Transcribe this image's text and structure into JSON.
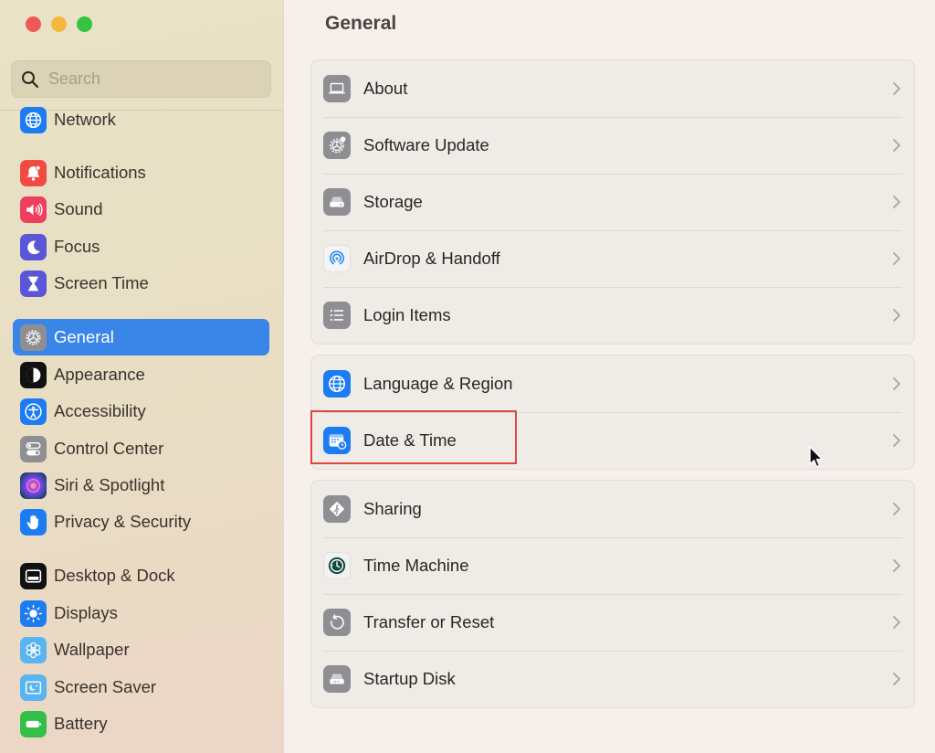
{
  "window": {
    "controls": [
      {
        "name": "close-button",
        "color": "#ed5a55"
      },
      {
        "name": "minimize-button",
        "color": "#f5b83a"
      },
      {
        "name": "maximize-button",
        "color": "#36c342"
      }
    ]
  },
  "search": {
    "placeholder": "Search",
    "value": "",
    "icon": "search-icon"
  },
  "sidebar": {
    "selected": "General",
    "accent_color": "#3a86e8",
    "items": [
      {
        "label": "Network",
        "icon": "globe-icon",
        "color": "#1d7cf2"
      },
      {
        "label": "Notifications",
        "icon": "bell-icon",
        "color": "#f04a42"
      },
      {
        "label": "Sound",
        "icon": "speaker-icon",
        "color": "#ee3f5d"
      },
      {
        "label": "Focus",
        "icon": "moon-icon",
        "color": "#5b56d8"
      },
      {
        "label": "Screen Time",
        "icon": "hourglass-icon",
        "color": "#5b56d8"
      },
      {
        "label": "General",
        "icon": "gear-icon",
        "color": "#8e8e93"
      },
      {
        "label": "Appearance",
        "icon": "appearance-icon",
        "color": "#111111"
      },
      {
        "label": "Accessibility",
        "icon": "accessibility-icon",
        "color": "#1d7cf2"
      },
      {
        "label": "Control Center",
        "icon": "toggles-icon",
        "color": "#8e8e93"
      },
      {
        "label": "Siri & Spotlight",
        "icon": "siri-icon",
        "color": "#7a2b5c"
      },
      {
        "label": "Privacy & Security",
        "icon": "hand-icon",
        "color": "#1d7cf2"
      },
      {
        "label": "Desktop & Dock",
        "icon": "dock-icon",
        "color": "#111111"
      },
      {
        "label": "Displays",
        "icon": "sun-icon",
        "color": "#1d7cf2"
      },
      {
        "label": "Wallpaper",
        "icon": "flower-icon",
        "color": "#5ab4ef"
      },
      {
        "label": "Screen Saver",
        "icon": "screensaver-icon",
        "color": "#5ab4ef"
      },
      {
        "label": "Battery",
        "icon": "battery-icon",
        "color": "#34c048"
      }
    ]
  },
  "main": {
    "title": "General",
    "groups": [
      {
        "rows": [
          {
            "label": "About",
            "icon": "laptop-icon",
            "color": "#8e8e93"
          },
          {
            "label": "Software Update",
            "icon": "gear-badge-icon",
            "color": "#8e8e93"
          },
          {
            "label": "Storage",
            "icon": "drive-icon",
            "color": "#8e8e93"
          },
          {
            "label": "AirDrop & Handoff",
            "icon": "airdrop-icon",
            "color": "#f2f2f2"
          },
          {
            "label": "Login Items",
            "icon": "list-icon",
            "color": "#8e8e93"
          }
        ]
      },
      {
        "rows": [
          {
            "label": "Language & Region",
            "icon": "globe-icon",
            "color": "#1d7cf2"
          },
          {
            "label": "Date & Time",
            "icon": "calendar-clock-icon",
            "color": "#1d7cf2"
          }
        ]
      },
      {
        "rows": [
          {
            "label": "Sharing",
            "icon": "sharing-icon",
            "color": "#8e8e93"
          },
          {
            "label": "Time Machine",
            "icon": "time-machine-icon",
            "color": "#0f4a3d"
          },
          {
            "label": "Transfer or Reset",
            "icon": "reset-icon",
            "color": "#8e8e93"
          },
          {
            "label": "Startup Disk",
            "icon": "disk-icon",
            "color": "#8e8e93"
          }
        ]
      }
    ],
    "highlighted_row": "Date & Time",
    "highlight_color": "#e0453f"
  }
}
